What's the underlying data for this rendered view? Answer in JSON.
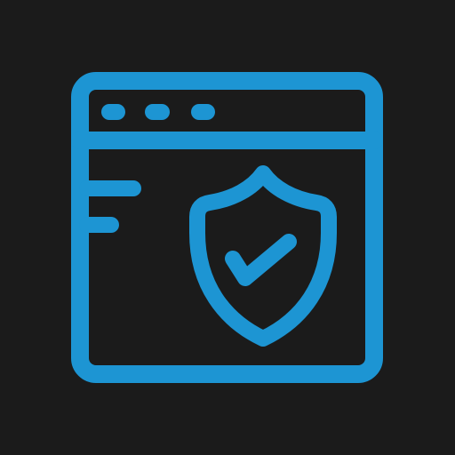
{
  "icon": {
    "name": "secure-browser-window-icon",
    "parts": [
      "browser-window",
      "shield-icon",
      "checkmark-icon"
    ]
  },
  "colors": {
    "background": "#1b1b1b",
    "accent": "#1d95d3"
  }
}
